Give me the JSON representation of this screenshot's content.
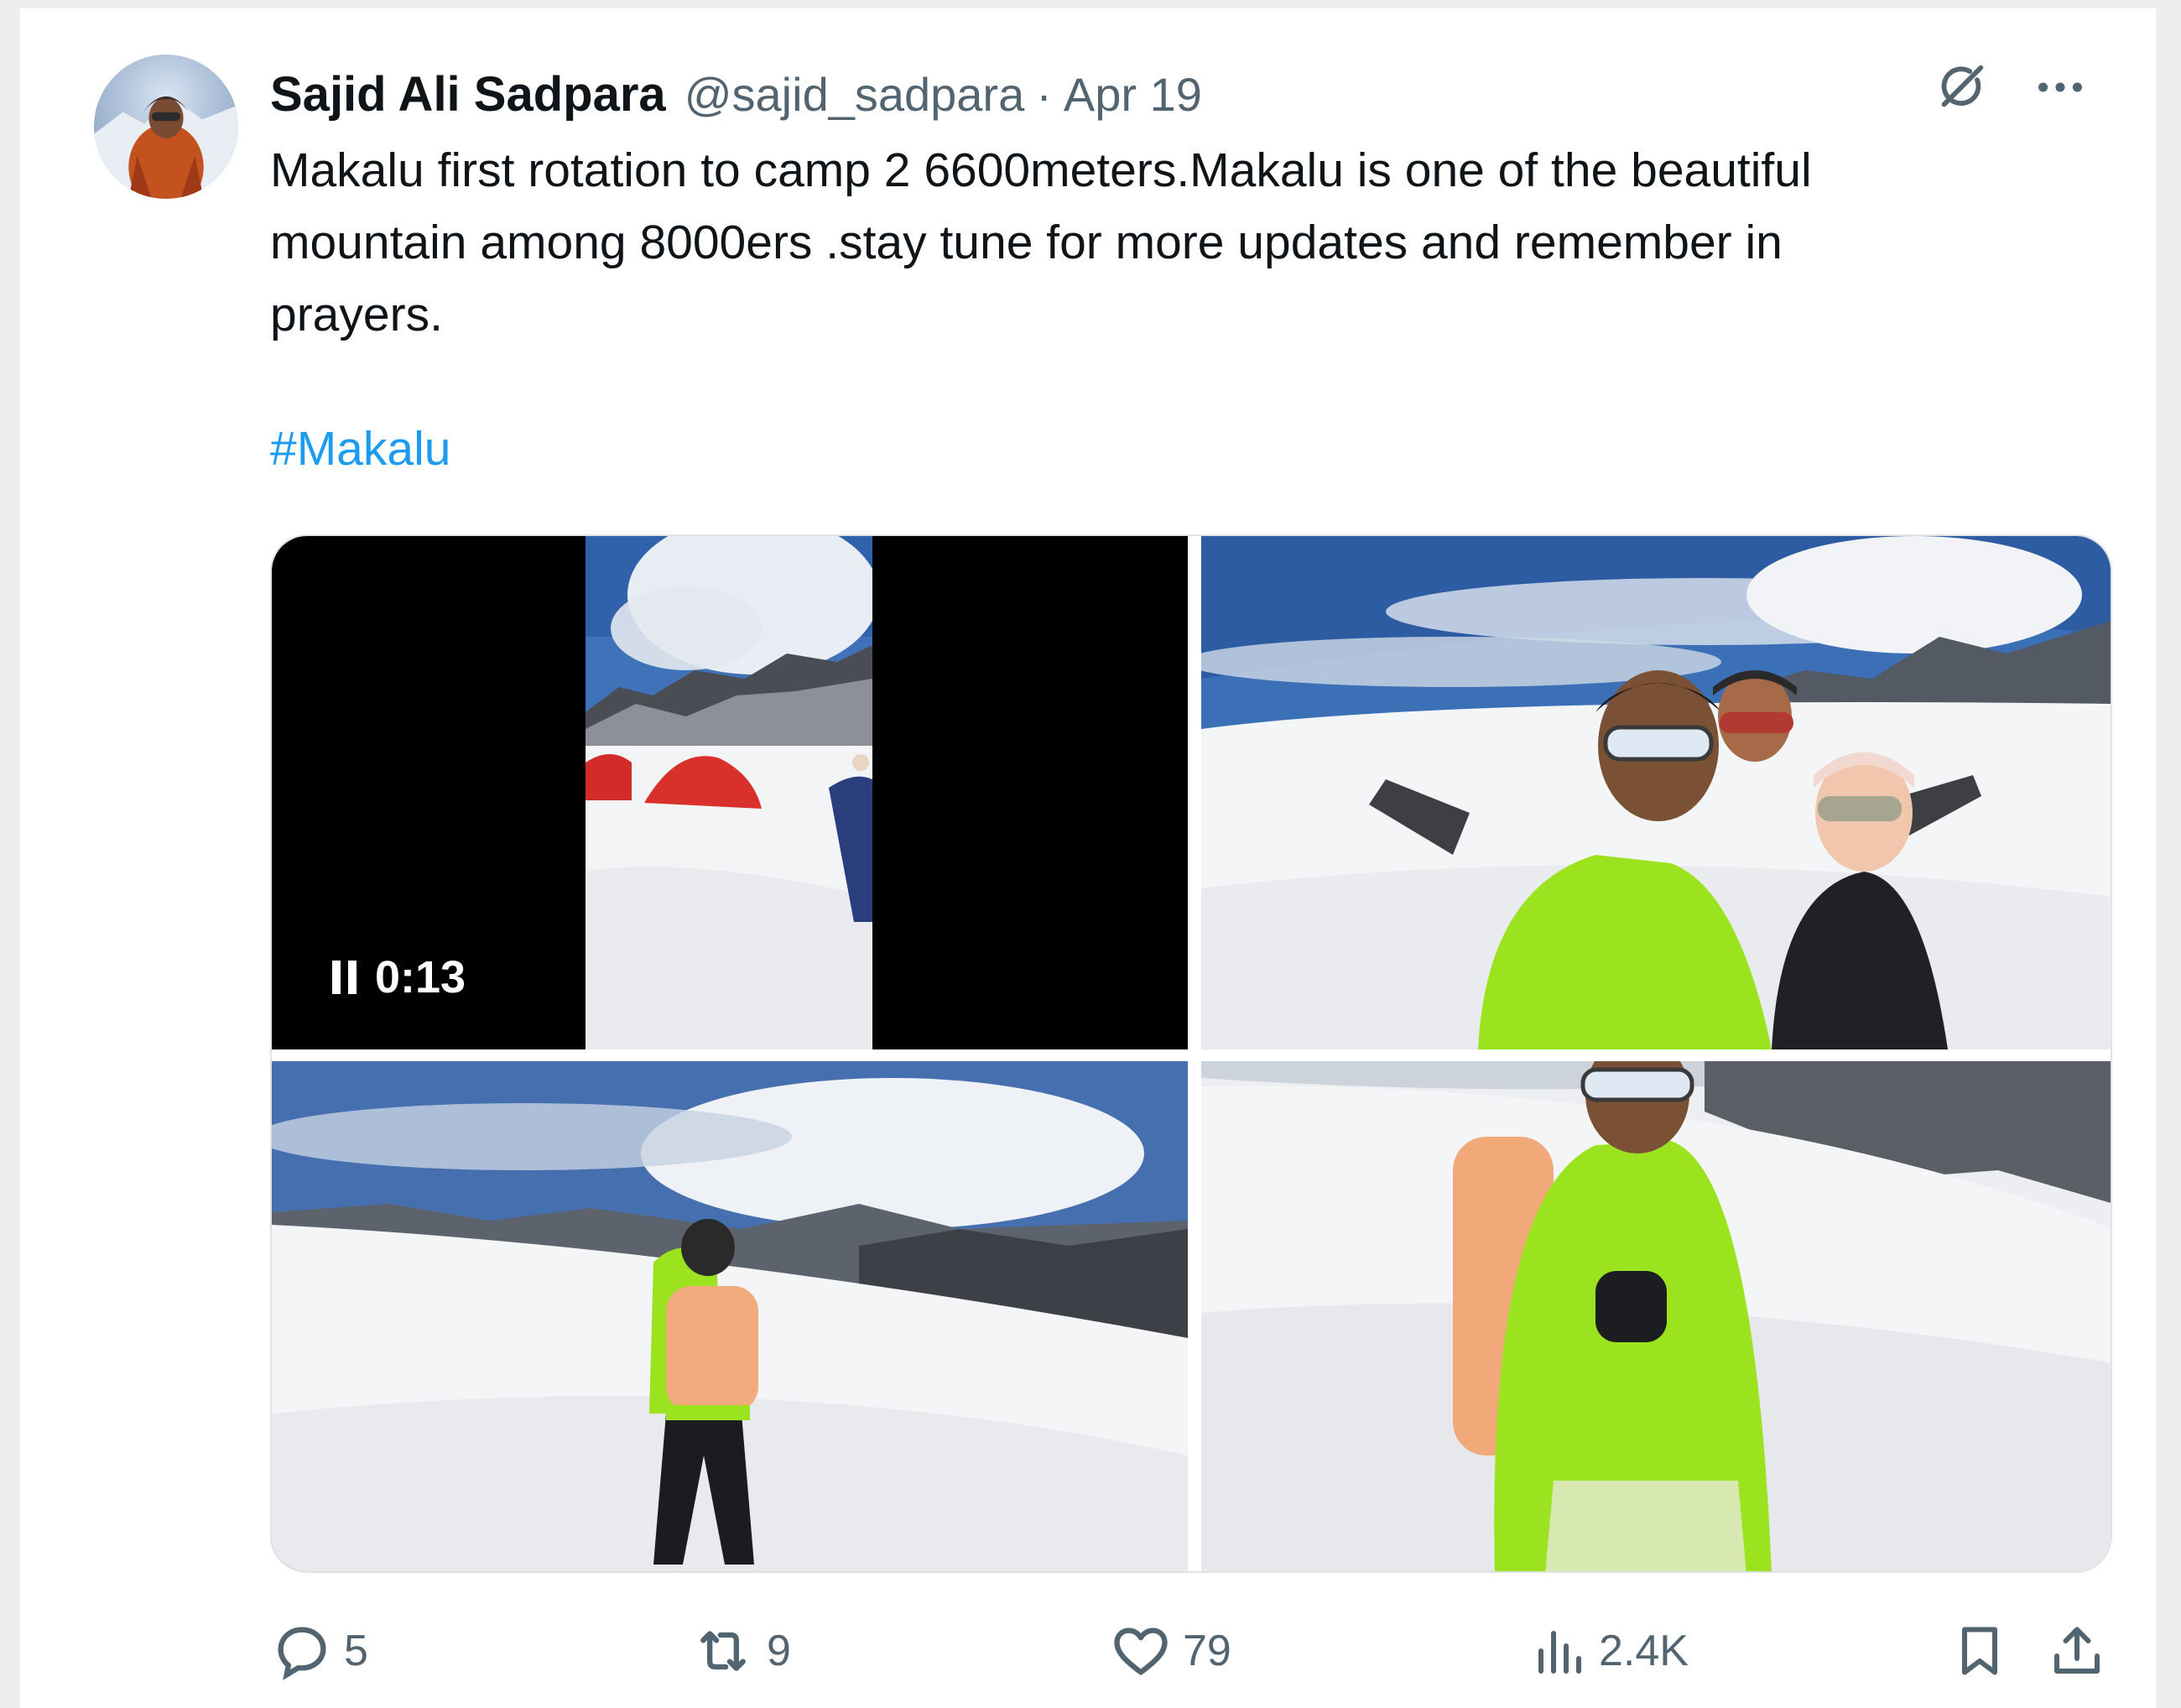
{
  "tweet": {
    "author_name": "Sajid Ali Sadpara",
    "handle": "@sajid_sadpara",
    "separator": "·",
    "date": "Apr 19",
    "text": "Makalu first rotation to camp 2 6600meters.Makalu is one of the beautiful\nmountain among 8000ers .stay tune for more updates and remember in\nprayers.",
    "hashtag": "#Makalu"
  },
  "media": {
    "video_time": "0:13",
    "video_state": "playing",
    "tiles": [
      {
        "kind": "video",
        "scene": "red tents on snow at camp"
      },
      {
        "kind": "photo",
        "scene": "three climbers selfie on glacier"
      },
      {
        "kind": "photo",
        "scene": "climber walking away on snowfield"
      },
      {
        "kind": "photo",
        "scene": "climber in green jacket giving thumbs up"
      }
    ]
  },
  "actions": {
    "replies": "5",
    "reposts": "9",
    "likes": "79",
    "views": "2.4K"
  },
  "icons": [
    "grok-icon",
    "more-icon",
    "reply-icon",
    "repost-icon",
    "like-icon",
    "views-icon",
    "bookmark-icon",
    "share-icon"
  ],
  "colors": {
    "text": "#0f1419",
    "secondary": "#536471",
    "link": "#1d9bf0",
    "jacket_green": "#9be21f"
  }
}
